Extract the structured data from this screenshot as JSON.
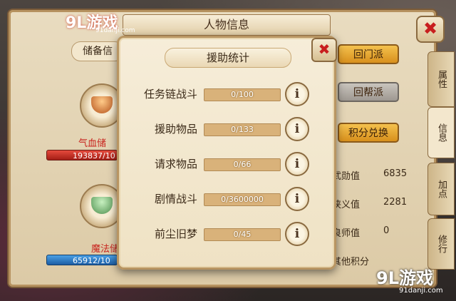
{
  "window": {
    "title": "人物信息",
    "close_glyph": "✖"
  },
  "logo_top": {
    "brand": "9L游戏",
    "domain": "91danji.com"
  },
  "left": {
    "reserve_tab": "储备信",
    "hp_label": "气血储",
    "hp_value": "193837/10",
    "mp_label": "魔法储",
    "mp_value": "65912/10"
  },
  "right_buttons": [
    {
      "label": "回门派",
      "style": "gold"
    },
    {
      "label": "回帮派",
      "style": "gray"
    },
    {
      "label": "积分兑换",
      "style": "gold"
    }
  ],
  "side_tabs": [
    "属性",
    "信息",
    "加点",
    "修行"
  ],
  "stats": [
    {
      "label": "武勋值",
      "value": "6835"
    },
    {
      "label": "侠义值",
      "value": "2281"
    },
    {
      "label": "良师值",
      "value": "0"
    },
    {
      "label": "其他积分",
      "value": ""
    }
  ],
  "modal": {
    "title": "援助统计",
    "close_glyph": "✖",
    "info_glyph": "i",
    "rows": [
      {
        "name": "任务链战斗",
        "text": "0/100",
        "progress": 0
      },
      {
        "name": "援助物品",
        "text": "0/133",
        "progress": 0
      },
      {
        "name": "请求物品",
        "text": "0/66",
        "progress": 0
      },
      {
        "name": "剧情战斗",
        "text": "0/3600000",
        "progress": 0
      },
      {
        "name": "前尘旧梦",
        "text": "0/45",
        "progress": 0
      }
    ]
  },
  "watermark": {
    "brand": "9L游戏",
    "domain": "91danji.com"
  },
  "colors": {
    "accent_gold": "#d8901c",
    "close_red": "#c81e1e",
    "hp_red": "#a51e16",
    "mp_blue": "#1d5ea5"
  }
}
